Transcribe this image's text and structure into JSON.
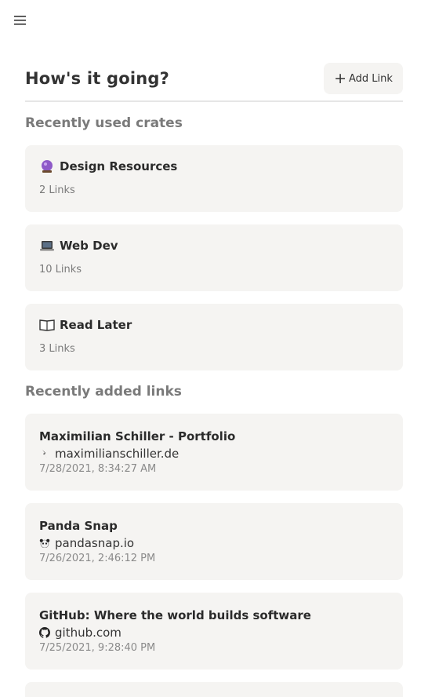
{
  "header": {
    "menu_icon": "hamburger-menu-icon"
  },
  "page": {
    "title": "How's it going?",
    "add_link_label": "Add Link",
    "add_link_icon": "plus-icon"
  },
  "sections": {
    "crates_title": "Recently used crates",
    "links_title": "Recently added links"
  },
  "crates": [
    {
      "emoji": "crystal-ball-icon",
      "name": "Design Resources",
      "count": "2 Links"
    },
    {
      "emoji": "laptop-icon",
      "name": "Web Dev",
      "count": "10 Links"
    },
    {
      "emoji": "open-book-icon",
      "name": "Read Later",
      "count": "3 Links"
    }
  ],
  "links": [
    {
      "title": "Maximilian Schiller - Portfolio",
      "favicon": "portfolio-favicon-icon",
      "domain": "maximilianschiller.de",
      "date": "7/28/2021, 8:34:27 AM"
    },
    {
      "title": "Panda Snap",
      "favicon": "panda-favicon-icon",
      "domain": "pandasnap.io",
      "date": "7/26/2021, 2:46:12 PM"
    },
    {
      "title": "GitHub: Where the world builds software",
      "favicon": "github-icon",
      "domain": "github.com",
      "date": "7/25/2021, 9:28:40 PM"
    }
  ],
  "colors": {
    "card_bg": "#f5f4f2",
    "divider": "#e6e6e6",
    "muted_text": "#7a7a7a"
  }
}
